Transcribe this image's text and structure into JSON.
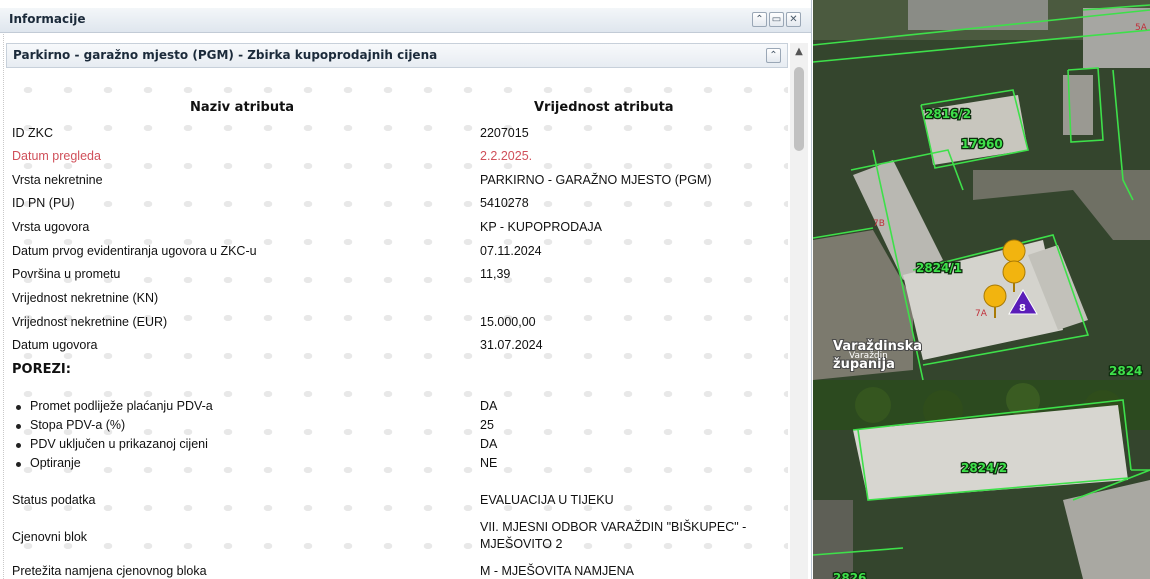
{
  "window": {
    "title": "Informacije",
    "buttons": [
      "collapse",
      "maximize",
      "close"
    ]
  },
  "section": {
    "title": "Parkirno - garažno mjesto (PGM) - Zbirka kupoprodajnih cijena"
  },
  "table": {
    "header_attr": "Naziv atributa",
    "header_val": "Vrijednost atributa",
    "rows": [
      {
        "label": "ID ZKC",
        "value": "2207015",
        "highlight": false
      },
      {
        "label": "Datum pregleda",
        "value": "2.2.2025.",
        "highlight": true
      },
      {
        "label": "Vrsta nekretnine",
        "value": "PARKIRNO - GARAŽNO MJESTO (PGM)",
        "highlight": false
      },
      {
        "label": "ID PN (PU)",
        "value": "5410278",
        "highlight": false
      },
      {
        "label": "Vrsta ugovora",
        "value": "KP - KUPOPRODAJA",
        "highlight": false
      },
      {
        "label": "Datum prvog evidentiranja ugovora u ZKC-u",
        "value": "07.11.2024",
        "highlight": false
      },
      {
        "label": "Površina u prometu",
        "value": "11,39",
        "highlight": false
      },
      {
        "label": "Vrijednost nekretnine (KN)",
        "value": "",
        "highlight": false
      },
      {
        "label": "Vrijednost nekretnine (EUR)",
        "value": "15.000,00",
        "highlight": false
      },
      {
        "label": "Datum ugovora",
        "value": "31.07.2024",
        "highlight": false
      }
    ],
    "taxes_heading": "POREZI:",
    "taxes": [
      {
        "label": "Promet podliježe plaćanju PDV-a",
        "value": "DA"
      },
      {
        "label": "Stopa PDV-a (%)",
        "value": "25"
      },
      {
        "label": "PDV uključen u prikazanoj cijeni",
        "value": "DA"
      },
      {
        "label": "Optiranje",
        "value": "NE"
      }
    ],
    "rows_after": [
      {
        "label": "Status podatka",
        "value": "EVALUACIJA U TIJEKU"
      },
      {
        "label": "Cjenovni blok",
        "value": "VII. MJESNI ODBOR VARAŽDIN \"BIŠKUPEC\" -",
        "value2": "MJEŠOVITO 2"
      },
      {
        "label": "Pretežita namjena cjenovnog bloka",
        "value": "M - MJEŠOVITA NAMJENA"
      }
    ]
  },
  "map": {
    "parcels": [
      "2816/2",
      "17960",
      "2824/1",
      "2824/2",
      "2824",
      "2826"
    ],
    "labels": [
      "7B",
      "7A",
      "8",
      "5A"
    ],
    "place_name_1": "Varaždinska",
    "place_name_2": "županija",
    "place_overlay": "Varaždin",
    "colors": {
      "parcel_line": "#3ee04a",
      "marker": "#f2b40f",
      "triangle": "#5a1db8"
    }
  }
}
